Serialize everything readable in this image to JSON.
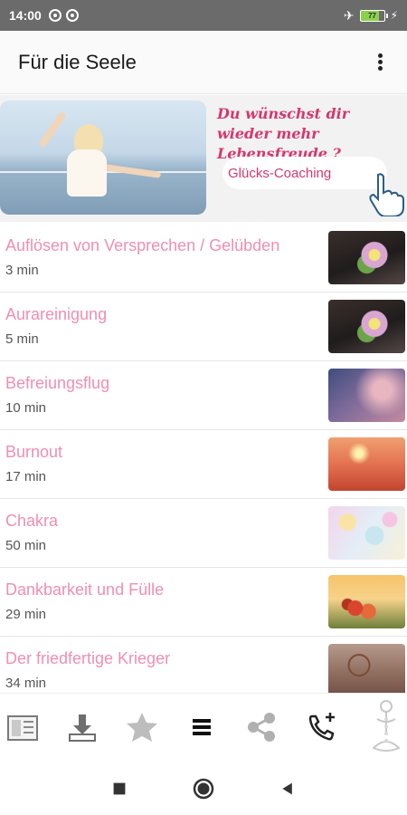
{
  "status_bar": {
    "time": "14:00",
    "battery_level": "77",
    "icons": [
      "notification-icon",
      "notification-icon",
      "airplane-icon",
      "battery-icon",
      "charging-icon"
    ]
  },
  "app_bar": {
    "title": "Für die Seele",
    "overflow_icon": "more-vert-icon"
  },
  "banner": {
    "headline": "Du wünschst dir wieder mehr Lebensfreude ?",
    "button_label": "Glücks-Coaching",
    "accent_color": "#d6386b"
  },
  "list": {
    "title_color": "#ef8fb1",
    "items": [
      {
        "title": "Auflösen von Versprechen / Gelübden",
        "duration": "3 min"
      },
      {
        "title": "Aurareinigung",
        "duration": "5 min"
      },
      {
        "title": "Befreiungsflug",
        "duration": "10 min"
      },
      {
        "title": "Burnout",
        "duration": "17 min"
      },
      {
        "title": "Chakra",
        "duration": "50 min"
      },
      {
        "title": "Dankbarkeit und Fülle",
        "duration": "29 min"
      },
      {
        "title": "Der friedfertige Krieger",
        "duration": "34 min"
      }
    ]
  },
  "toolbar": {
    "buttons": [
      "catalog-icon",
      "download-icon",
      "star-icon",
      "menu-icon",
      "share-icon",
      "phone-add-icon",
      "meditation-icon"
    ]
  },
  "nav_bar": {
    "buttons": [
      "recents-icon",
      "home-icon",
      "back-icon"
    ]
  }
}
